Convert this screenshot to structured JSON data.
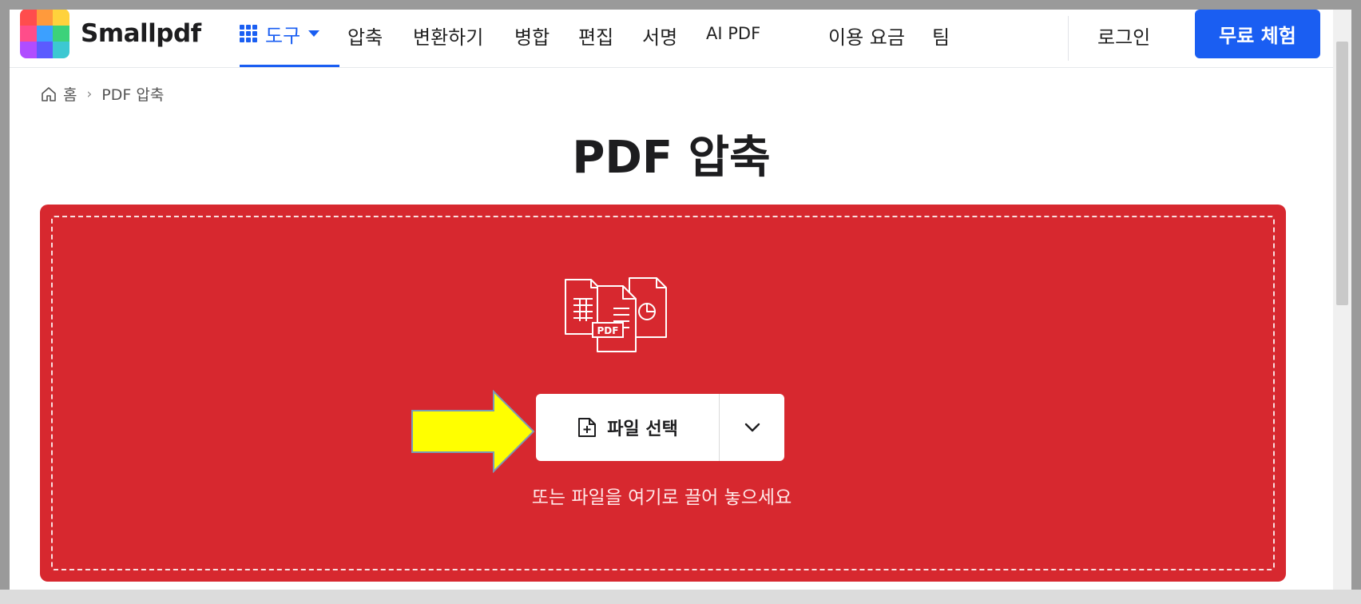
{
  "header": {
    "brand": "Smallpdf",
    "tools_label": "도구",
    "nav": [
      "압축",
      "변환하기",
      "병합",
      "편집",
      "서명",
      "AI PDF"
    ],
    "pricing": "이용 요금",
    "team": "팀",
    "login": "로그인",
    "cta": "무료 체험"
  },
  "breadcrumb": {
    "home": "홈",
    "current": "PDF 압축"
  },
  "main": {
    "title": "PDF 압축",
    "choose_file": "파일 선택",
    "drop_hint": "또는 파일을 여기로 끌어 놓으세요",
    "illustration_badge": "PDF"
  },
  "colors": {
    "accent": "#1a5ef2",
    "dropzone": "#d7282f",
    "arrow": "#ffff00"
  },
  "icons": [
    "tools-grid-icon",
    "caret-down-icon",
    "home-icon",
    "file-add-icon",
    "chevron-down-icon",
    "files-illustration-icon",
    "pointer-arrow-icon"
  ]
}
